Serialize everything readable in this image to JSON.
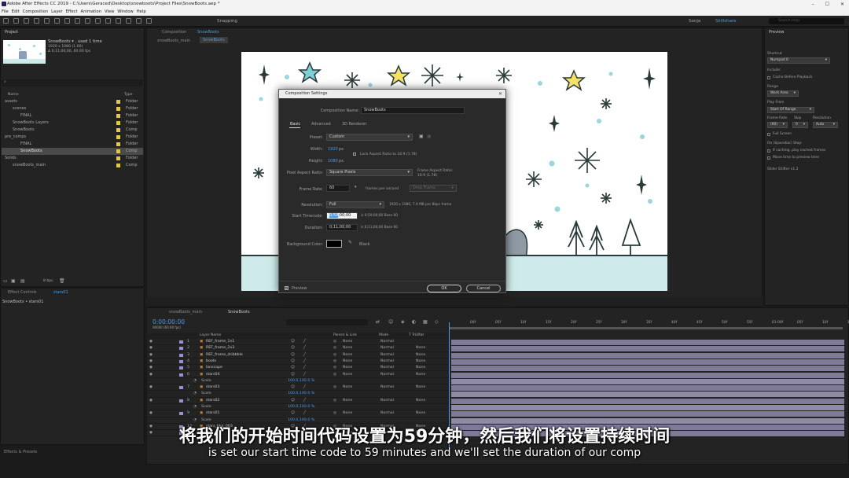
{
  "window": {
    "title": "Adobe After Effects CC 2019 - C:\\Users\\Geraced\\Desktop\\snowboots\\Project Files\\SnowBoots.aep *"
  },
  "menu": [
    "File",
    "Edit",
    "Composition",
    "Layer",
    "Effect",
    "Animation",
    "View",
    "Window",
    "Help"
  ],
  "toolbar": {
    "snapping": "Snapping",
    "workspace_user": "Sonja",
    "workspace_active": "Skillshare",
    "search_placeholder": "Search Help"
  },
  "project": {
    "tab": "Project",
    "item_name": "SnowBoots ▾ , used 1 time",
    "item_size": "1920 x 1080 (1.00)",
    "item_duration": "Δ 0;11;00;00, 60.00 fps",
    "col_name": "Name",
    "col_type": "Type",
    "rows": [
      {
        "name": "assets",
        "type": "Folder"
      },
      {
        "name": "scenes",
        "type": "Folder"
      },
      {
        "name": "FINAL",
        "type": "Folder"
      },
      {
        "name": "SnowBoots Layers",
        "type": "Folder"
      },
      {
        "name": "SnowBoots",
        "type": "Comp"
      },
      {
        "name": "pre_comps",
        "type": "Folder"
      },
      {
        "name": "FINAL",
        "type": "Folder"
      },
      {
        "name": "SnowBoots",
        "type": "Comp"
      },
      {
        "name": "Solids",
        "type": "Folder"
      },
      {
        "name": "snowBoots_main",
        "type": "Comp"
      }
    ],
    "bpc": "8 bpc"
  },
  "effect_controls": {
    "tab": "Effect Controls",
    "layer": "stars01",
    "path": "SnowBoots • stars01"
  },
  "effects_presets": {
    "tab": "Effects & Presets"
  },
  "viewer": {
    "tab_prefix": "Composition",
    "tab_comp": "SnowBoots",
    "breadcrumb_1": "snowBoots_main",
    "breadcrumb_2": "SnowBoots"
  },
  "dialog": {
    "title": "Composition Settings",
    "comp_name_label": "Composition Name:",
    "comp_name": "SnowBoots",
    "tabs": [
      "Basic",
      "Advanced",
      "3D Renderer"
    ],
    "preset_label": "Preset:",
    "preset": "Custom",
    "width_label": "Width:",
    "width": "1920",
    "height_label": "Height:",
    "height": "1080",
    "px": "px",
    "lock_aspect": "Lock Aspect Ratio to 16:9 (1.78)",
    "par_label": "Pixel Aspect Ratio:",
    "par": "Square Pixels",
    "frame_aspect_label": "Frame Aspect Ratio:",
    "frame_aspect": "16:9 (1.78)",
    "frame_rate_label": "Frame Rate:",
    "frame_rate": "60",
    "fps_label": "frames per second",
    "drop_frame": "Drop Frame",
    "resolution_label": "Resolution:",
    "resolution": "Full",
    "resolution_info": "1920 x 1080, 7.9 MB per 8bpc frame",
    "start_tc_label": "Start Timecode:",
    "start_tc_sel": "0;59",
    "start_tc_rest": ";00;00",
    "start_tc_info": "is 0;59;00;00  Base 60",
    "duration_label": "Duration:",
    "duration": "0;11;00;00",
    "duration_info": "is 0;11;00;00  Base 60",
    "bg_label": "Background Color:",
    "bg_name": "Black",
    "bg_color": "#000000",
    "preview": "Preview",
    "ok": "OK",
    "cancel": "Cancel"
  },
  "preview_panel": {
    "tab": "Preview",
    "shortcut_label": "Shortcut",
    "shortcut": "Numpad 0",
    "include": "Include:",
    "cache_before": "Cache Before Playback",
    "range_label": "Range",
    "range": "Work Area",
    "play_from_label": "Play From",
    "play_from": "Start Of Range",
    "frame_rate_label": "Frame Rate",
    "skip_label": "Skip",
    "resolution_label": "Resolution",
    "frame_rate": "(60)",
    "skip": "0",
    "resolution": "Auto",
    "full_screen": "Full Screen",
    "on_stop": "On (Spacebar) Stop:",
    "if_caching": "If caching, play cached frames",
    "move_time": "Move time to preview time",
    "slider": "Slider Shifter v1.2"
  },
  "timeline": {
    "tab_1": "snowBoots_main",
    "tab_2": "SnowBoots",
    "timecode": "0:00:00:00",
    "frames": "00000 (60.00 fps)",
    "col_layer": "Layer Name",
    "col_parent": "Parent & Link",
    "col_mode": "Mode",
    "col_trk": "T  TrkMat",
    "ruler": [
      "00f",
      "05f",
      "10f",
      "15f",
      "20f",
      "25f",
      "30f",
      "35f",
      "40f",
      "45f",
      "50f",
      "55f",
      "01:00f",
      "05f",
      "10f",
      "15f"
    ],
    "rows": [
      {
        "num": "1",
        "name": "REF_frame_1x1",
        "mode": "Normal",
        "parent": "None",
        "trk": ""
      },
      {
        "num": "2",
        "name": "REF_frame_2x3",
        "mode": "Normal",
        "parent": "None",
        "trk": "None"
      },
      {
        "num": "3",
        "name": "REF_frame_dribbble",
        "mode": "Normal",
        "parent": "None",
        "trk": "None"
      },
      {
        "num": "4",
        "name": "boots",
        "mode": "Normal",
        "parent": "None",
        "trk": "None"
      },
      {
        "num": "5",
        "name": "lanscape",
        "mode": "Normal",
        "parent": "None",
        "trk": "None"
      },
      {
        "num": "6",
        "name": "stars04",
        "mode": "Normal",
        "parent": "None",
        "trk": "None"
      },
      {
        "num": "",
        "name": "Scale",
        "mode": "",
        "parent": "",
        "trk": "",
        "prop": "100.0,100.0 %"
      },
      {
        "num": "7",
        "name": "stars03",
        "mode": "Normal",
        "parent": "None",
        "trk": "None"
      },
      {
        "num": "",
        "name": "Scale",
        "mode": "",
        "parent": "",
        "trk": "",
        "prop": "100.0,100.0 %"
      },
      {
        "num": "8",
        "name": "stars02",
        "mode": "Normal",
        "parent": "None",
        "trk": "None"
      },
      {
        "num": "",
        "name": "Scale",
        "mode": "",
        "parent": "",
        "trk": "",
        "prop": "100.0,100.0 %"
      },
      {
        "num": "9",
        "name": "stars01",
        "mode": "Normal",
        "parent": "None",
        "trk": "None"
      },
      {
        "num": "",
        "name": "Scale",
        "mode": "",
        "parent": "",
        "trk": "",
        "prop": "100.0,100.0 %"
      },
      {
        "num": "13",
        "name": "stars_bkg_003",
        "mode": "Normal",
        "parent": "None",
        "trk": "None"
      },
      {
        "num": "14",
        "name": "",
        "mode": "Normal",
        "parent": "None",
        "trk": "None"
      }
    ]
  },
  "subtitles": {
    "zh": "将我们的开始时间代码设置为59分钟，然后我们将设置持续时间",
    "en": "is set our start time code to 59 minutes and we'll set the duration of our comp"
  },
  "colors": {
    "accent_blue": "#4a9ae8",
    "snow": "#9ad6dc",
    "star_fill": "#f4e06a",
    "star_blue": "#7fcfd6",
    "layer_label": "#9b8fd0"
  }
}
